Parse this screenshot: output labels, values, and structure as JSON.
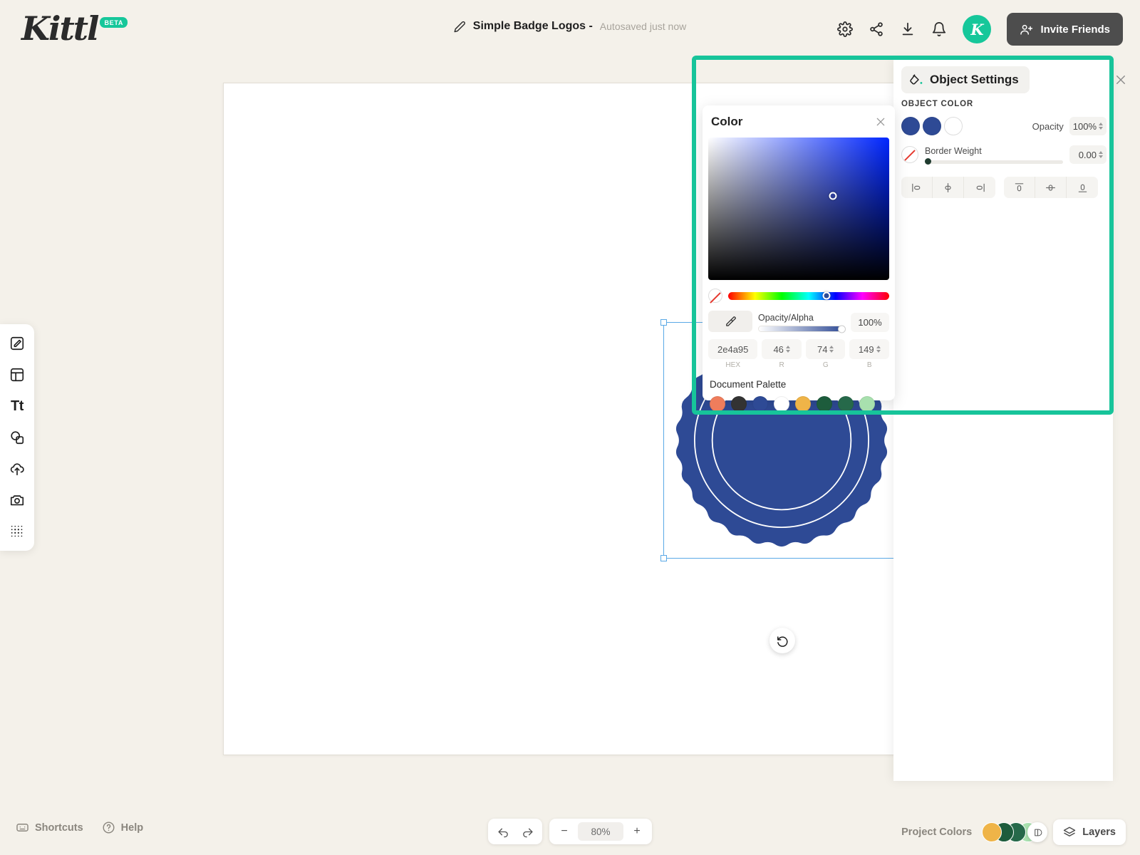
{
  "app": {
    "logo_text": "Kittl",
    "logo_badge": "BETA",
    "brand_color": "#16c79a"
  },
  "header": {
    "doc_title": "Simple Badge Logos -",
    "autosave_status": "Autosaved just now",
    "avatar_letter": "K",
    "invite_label": "Invite Friends",
    "icons": [
      "gear-icon",
      "share-icon",
      "download-icon",
      "bell-icon"
    ]
  },
  "left_toolbar": {
    "tools": [
      {
        "name": "design-edit-icon"
      },
      {
        "name": "templates-icon"
      },
      {
        "name": "text-icon",
        "label": "Tt"
      },
      {
        "name": "elements-icon"
      },
      {
        "name": "uploads-icon"
      },
      {
        "name": "photos-icon"
      },
      {
        "name": "texture-grid-icon"
      }
    ]
  },
  "canvas": {
    "shape_fill": "#2e4a95",
    "ring_color": "#ffffff",
    "selection_color": "#5aa9e6",
    "rotate_icon": "rotate-counterclockwise-icon"
  },
  "object_settings": {
    "title": "Object Settings",
    "icon": "paint-bucket-icon",
    "close_icon": "close-icon",
    "section_label": "OBJECT COLOR",
    "swatches": [
      "#2e4a95",
      "#2e4a95",
      "#ffffff"
    ],
    "opacity_label": "Opacity",
    "opacity_value": "100%",
    "border_weight_label": "Border Weight",
    "border_weight_value": "0.00",
    "border_weight_slider_pct": 2,
    "align_buttons": [
      "align-left-icon",
      "align-center-horizontal-icon",
      "align-right-icon",
      "align-top-icon",
      "align-middle-vertical-icon",
      "align-bottom-icon"
    ]
  },
  "color_popup": {
    "title": "Color",
    "close_icon": "close-icon",
    "no_color_icon": "no-color-slash-icon",
    "eyedropper_icon": "eyedropper-icon",
    "alpha_label": "Opacity/Alpha",
    "alpha_value": "100%",
    "hex_value": "2e4a95",
    "r_value": "46",
    "g_value": "74",
    "b_value": "149",
    "hex_caption": "HEX",
    "r_caption": "R",
    "g_caption": "G",
    "b_caption": "B",
    "palette_label": "Document Palette",
    "palette": [
      "#ef7d5c",
      "#333333",
      "#2e4a95",
      "#ffffff",
      "#efb448",
      "#1d5c3c",
      "#26694a",
      "#a8e0ae"
    ]
  },
  "footer": {
    "shortcuts_label": "Shortcuts",
    "help_label": "Help",
    "undo_icon": "undo-arrow-icon",
    "redo_icon": "redo-arrow-icon",
    "zoom_out_label": "−",
    "zoom_value": "80%",
    "zoom_in_label": "+",
    "project_colors_label": "Project Colors",
    "project_colors": [
      "#efb448",
      "#1d5c3c",
      "#26694a",
      "#a8e0ae"
    ],
    "layers_label": "Layers",
    "layers_icon": "layers-icon"
  }
}
